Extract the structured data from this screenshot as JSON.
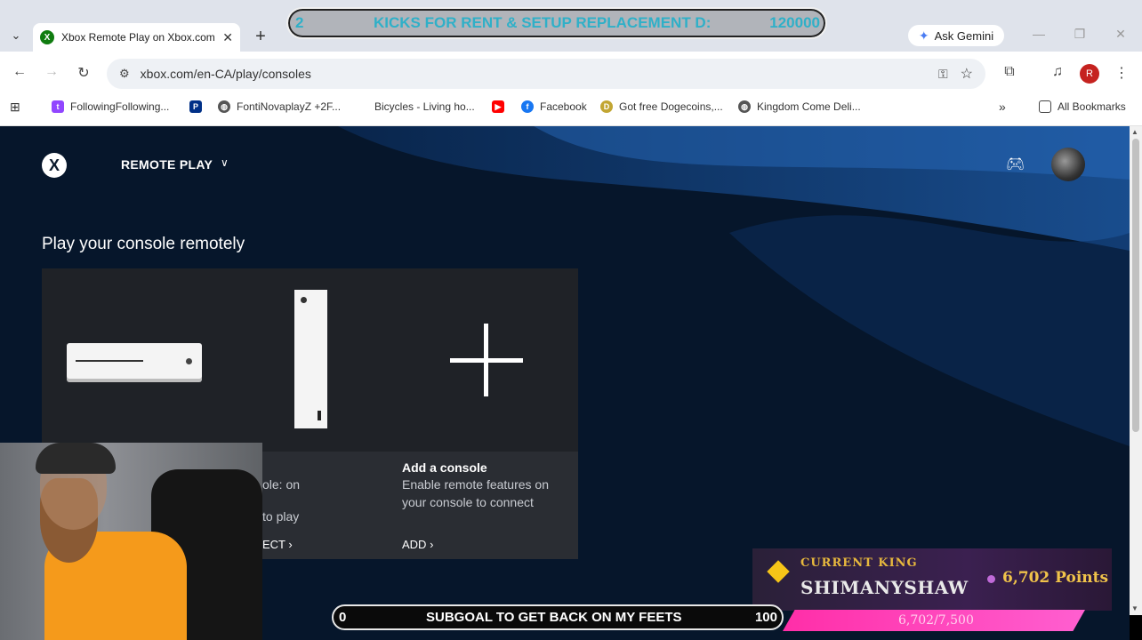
{
  "browser": {
    "tab_title": "Xbox Remote Play on Xbox.com",
    "tab_close": "✕",
    "new_tab": "+",
    "ask_gemini": "Ask Gemini",
    "url": "xbox.com/en-CA/play/consoles",
    "profile_initial": "R",
    "bookmarks": [
      {
        "label": "FollowingFollowing...",
        "icon_color": "#9146ff",
        "icon": "twitch-icon"
      },
      {
        "label": "",
        "icon_color": "#003087",
        "icon": "paypal-icon"
      },
      {
        "label": "FontiNovaplayZ +2F...",
        "icon_color": "#555555",
        "icon": "globe-icon"
      },
      {
        "label": "Bicycles - Living ho...",
        "icon_color": "#ffffff",
        "icon": "blank-icon"
      },
      {
        "label": "",
        "icon_color": "#ff0000",
        "icon": "youtube-icon"
      },
      {
        "label": "Facebook",
        "icon_color": "#1877f2",
        "icon": "facebook-icon"
      },
      {
        "label": "Got free Dogecoins,...",
        "icon_color": "#c2a633",
        "icon": "dogecoin-icon"
      },
      {
        "label": "Kingdom Come Deli...",
        "icon_color": "#555555",
        "icon": "globe-icon"
      }
    ],
    "bookmarks_overflow": "»",
    "all_bookmarks": "All Bookmarks"
  },
  "stream_banner": {
    "left": "2",
    "text": "KICKS FOR RENT & SETUP REPLACEMENT D:",
    "right": "120000"
  },
  "xbox": {
    "nav_title": "REMOTE PLAY",
    "heading": "Play your console remotely",
    "consoles": [
      {
        "line1": "ole: on",
        "line2": "to play",
        "action": "ECT"
      }
    ],
    "add_console": {
      "title": "Add a console",
      "desc_line1": "Enable remote features on",
      "desc_line2": "your console to connect",
      "action": "ADD"
    }
  },
  "king": {
    "label": "CURRENT KING",
    "name": "SHIMANYSHAW",
    "points": "6,702 Points",
    "progress": "6,702/7,500",
    "progress_fraction": 0.8936
  },
  "subgoal": {
    "left": "0",
    "text": "SUBGOAL TO GET BACK ON MY FEETS",
    "right": "100"
  }
}
